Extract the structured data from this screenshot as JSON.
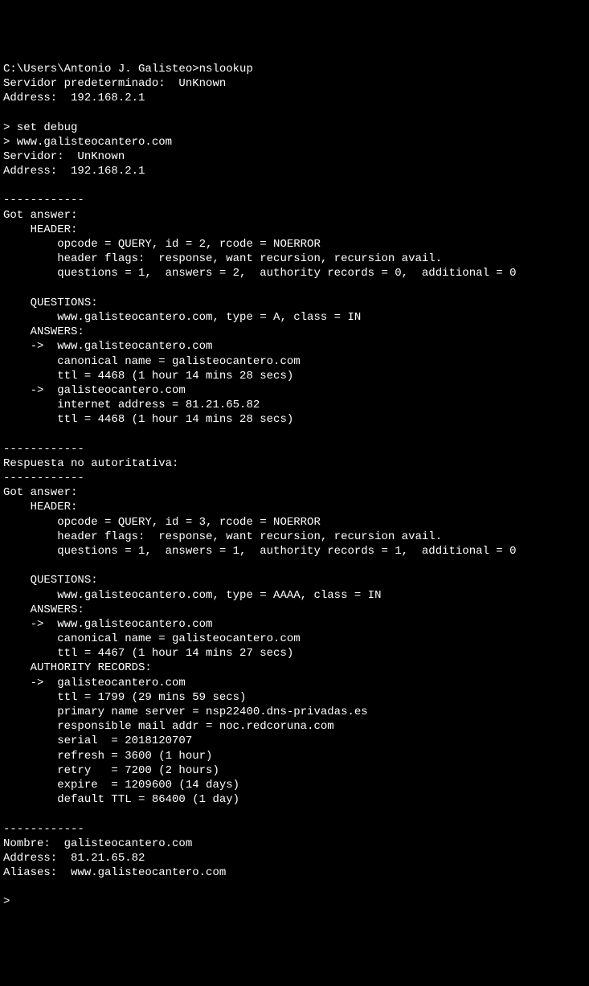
{
  "prompt1": "C:\\Users\\Antonio J. Galisteo>nslookup",
  "default_server_label": "Servidor predeterminado:  UnKnown",
  "address1": "Address:  192.168.2.1",
  "cmd1": "> set debug",
  "cmd2": "> www.galisteocantero.com",
  "server_label": "Servidor:  UnKnown",
  "address2": "Address:  192.168.2.1",
  "sep1": "------------",
  "got_answer1": "Got answer:",
  "header1": "    HEADER:",
  "opcode1": "        opcode = QUERY, id = 2, rcode = NOERROR",
  "flags1": "        header flags:  response, want recursion, recursion avail.",
  "counts1": "        questions = 1,  answers = 2,  authority records = 0,  additional = 0",
  "questions1": "    QUESTIONS:",
  "q1": "        www.galisteocantero.com, type = A, class = IN",
  "answers1": "    ANSWERS:",
  "a1_name": "    ->  www.galisteocantero.com",
  "a1_cname": "        canonical name = galisteocantero.com",
  "a1_ttl": "        ttl = 4468 (1 hour 14 mins 28 secs)",
  "a2_name": "    ->  galisteocantero.com",
  "a2_addr": "        internet address = 81.21.65.82",
  "a2_ttl": "        ttl = 4468 (1 hour 14 mins 28 secs)",
  "sep2": "------------",
  "nonauth": "Respuesta no autoritativa:",
  "sep3": "------------",
  "got_answer2": "Got answer:",
  "header2": "    HEADER:",
  "opcode2": "        opcode = QUERY, id = 3, rcode = NOERROR",
  "flags2": "        header flags:  response, want recursion, recursion avail.",
  "counts2": "        questions = 1,  answers = 1,  authority records = 1,  additional = 0",
  "questions2": "    QUESTIONS:",
  "q2": "        www.galisteocantero.com, type = AAAA, class = IN",
  "answers2": "    ANSWERS:",
  "b1_name": "    ->  www.galisteocantero.com",
  "b1_cname": "        canonical name = galisteocantero.com",
  "b1_ttl": "        ttl = 4467 (1 hour 14 mins 27 secs)",
  "auth_records": "    AUTHORITY RECORDS:",
  "auth_name": "    ->  galisteocantero.com",
  "auth_ttl": "        ttl = 1799 (29 mins 59 secs)",
  "auth_ns": "        primary name server = nsp22400.dns-privadas.es",
  "auth_mail": "        responsible mail addr = noc.redcoruna.com",
  "auth_serial": "        serial  = 2018120707",
  "auth_refresh": "        refresh = 3600 (1 hour)",
  "auth_retry": "        retry   = 7200 (2 hours)",
  "auth_expire": "        expire  = 1209600 (14 days)",
  "auth_default_ttl": "        default TTL = 86400 (1 day)",
  "sep4": "------------",
  "nombre": "Nombre:  galisteocantero.com",
  "address3": "Address:  81.21.65.82",
  "aliases": "Aliases:  www.galisteocantero.com",
  "prompt2": "> "
}
